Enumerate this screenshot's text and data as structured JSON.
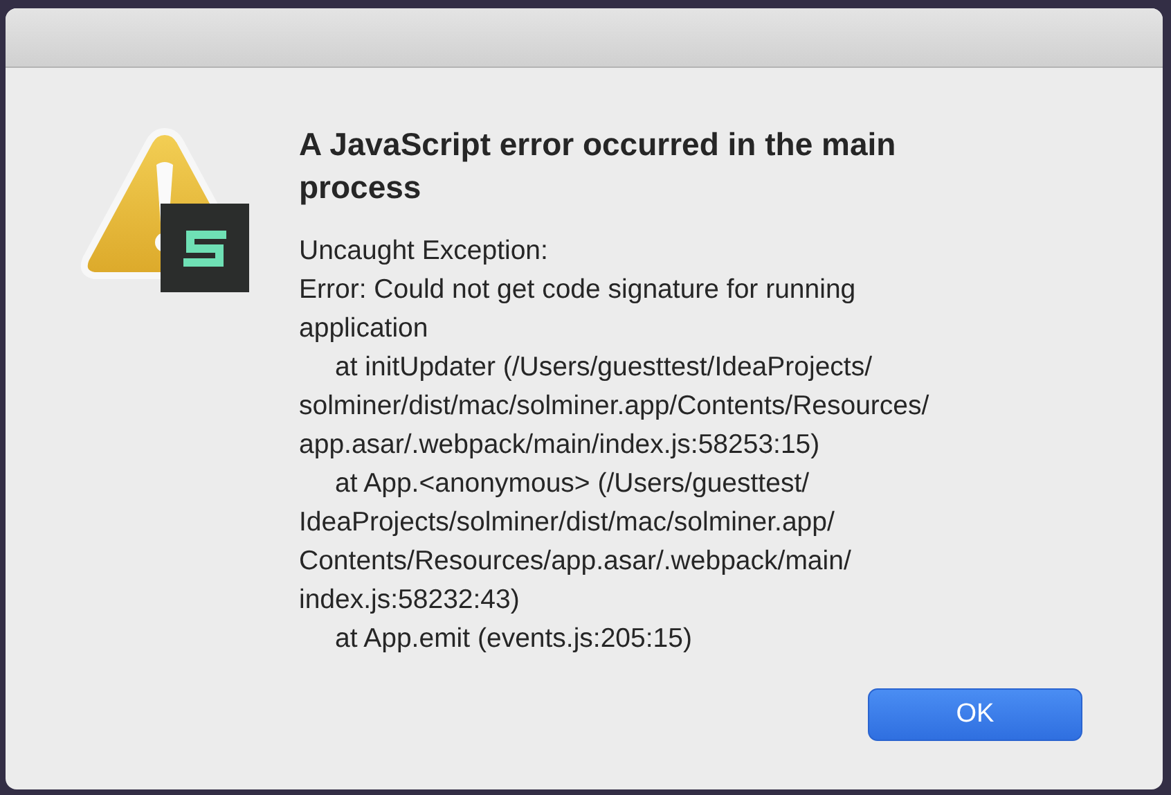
{
  "dialog": {
    "title": "A JavaScript error occurred in the main process",
    "message_lines": [
      {
        "kind": "plain",
        "text": "Uncaught Exception:"
      },
      {
        "kind": "plain",
        "text": "Error: Could not get code signature for running"
      },
      {
        "kind": "plain",
        "text": "application"
      },
      {
        "kind": "frame",
        "text": "at initUpdater (/Users/guesttest/IdeaProjects/"
      },
      {
        "kind": "plain",
        "text": "solminer/dist/mac/solminer.app/Contents/Resources/"
      },
      {
        "kind": "plain",
        "text": "app.asar/.webpack/main/index.js:58253:15)"
      },
      {
        "kind": "frame",
        "text": "at App.<anonymous> (/Users/guesttest/"
      },
      {
        "kind": "plain",
        "text": "IdeaProjects/solminer/dist/mac/solminer.app/"
      },
      {
        "kind": "plain",
        "text": "Contents/Resources/app.asar/.webpack/main/"
      },
      {
        "kind": "plain",
        "text": "index.js:58232:43)"
      },
      {
        "kind": "frame",
        "text": "at App.emit (events.js:205:15)"
      }
    ],
    "buttons": [
      {
        "label": "OK",
        "default": true
      }
    ]
  }
}
